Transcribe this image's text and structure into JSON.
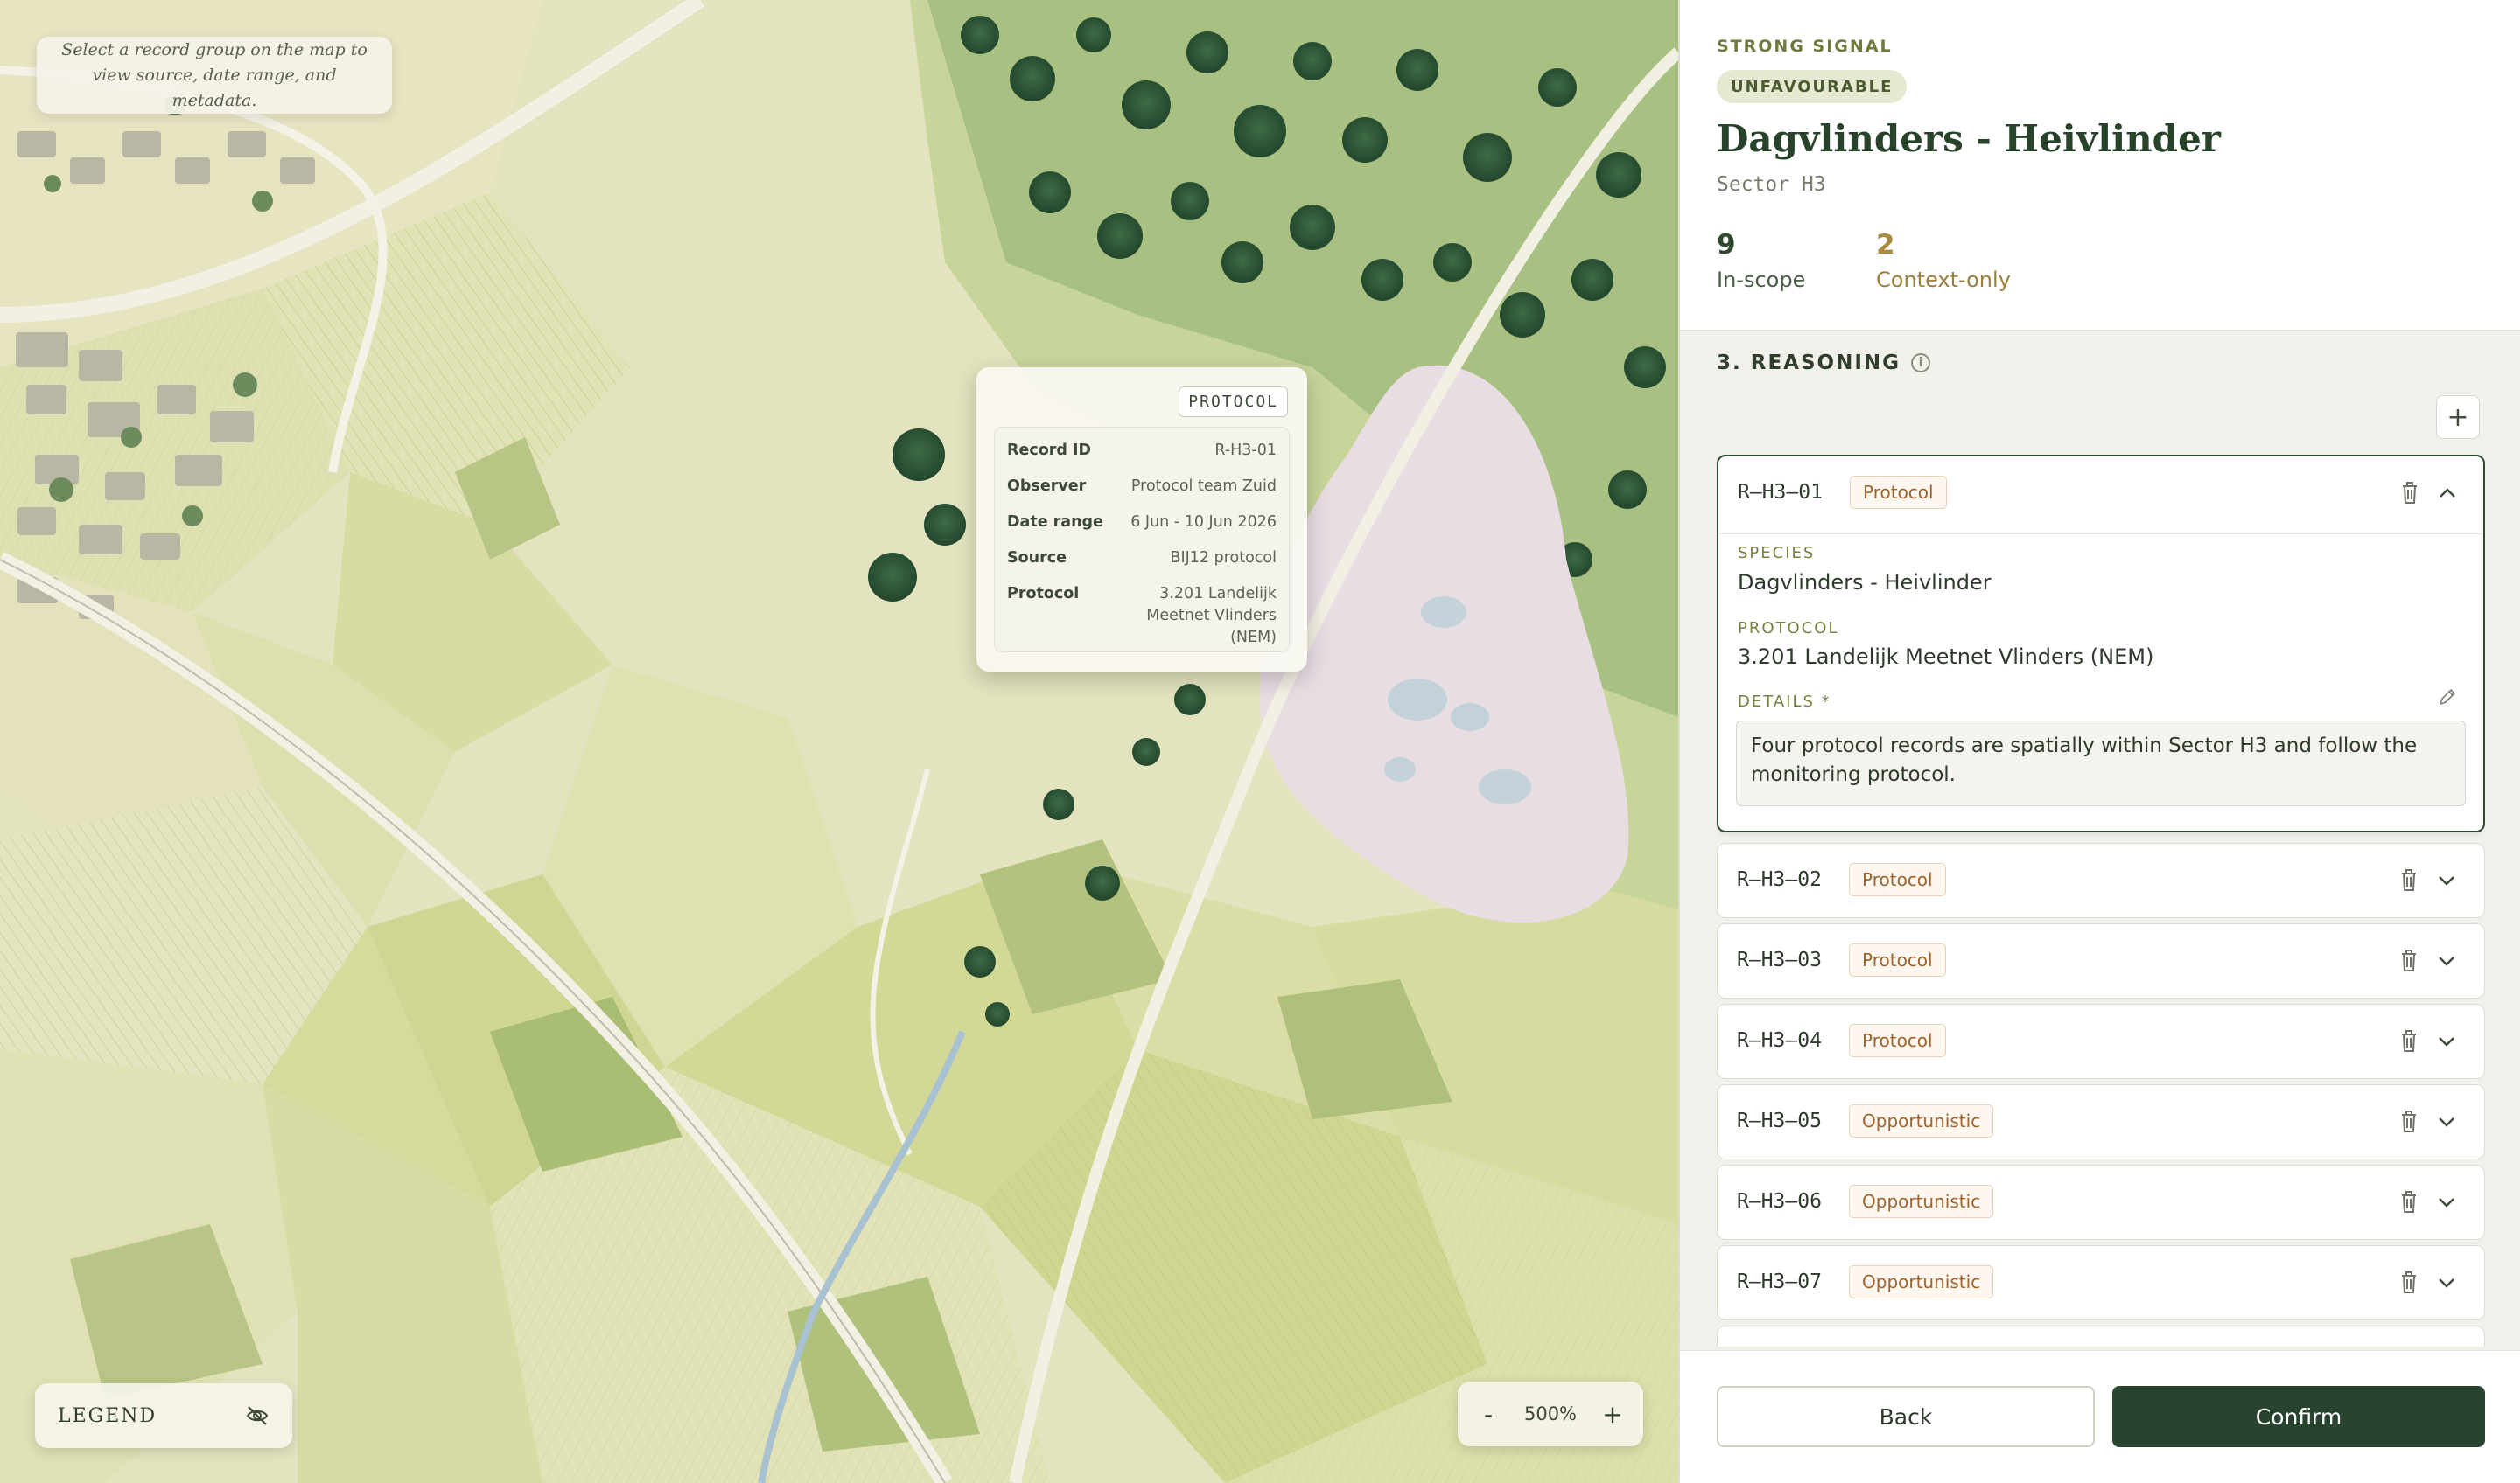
{
  "map": {
    "hint_text": "Select a record group on the map to view source, date range, and metadata.",
    "popup": {
      "tag": "PROTOCOL",
      "rows": [
        {
          "key": "Record ID",
          "value": "R-H3-01"
        },
        {
          "key": "Observer",
          "value": "Protocol team Zuid"
        },
        {
          "key": "Date range",
          "value": "6 Jun - 10 Jun 2026"
        },
        {
          "key": "Source",
          "value": "BIJ12 protocol"
        },
        {
          "key": "Protocol",
          "value": "3.201 Landelijk Meetnet Vlinders (NEM)"
        }
      ]
    },
    "legend_label": "LEGEND",
    "legend_icon": "eye-off-icon",
    "zoom": {
      "minus": "-",
      "value": "500%",
      "plus": "+"
    }
  },
  "panel": {
    "eyebrow": "STRONG SIGNAL",
    "status_pill": "UNFAVOURABLE",
    "title": "Dagvlinders - Heivlinder",
    "subtitle": "Sector H3",
    "stats": [
      {
        "value": "9",
        "label": "In-scope"
      },
      {
        "value": "2",
        "label": "Context-only"
      }
    ],
    "section_title": "3. REASONING",
    "add_label": "+",
    "records": [
      {
        "id": "R–H3–01",
        "badge": "Protocol",
        "expanded": true,
        "species_label": "SPECIES",
        "species": "Dagvlinders - Heivlinder",
        "protocol_label": "PROTOCOL",
        "protocol": "3.201 Landelijk Meetnet Vlinders (NEM)",
        "details_label": "DETAILS *",
        "details": "Four protocol records are spatially within Sector H3 and follow the monitoring protocol."
      },
      {
        "id": "R–H3–02",
        "badge": "Protocol"
      },
      {
        "id": "R–H3–03",
        "badge": "Protocol"
      },
      {
        "id": "R–H3–04",
        "badge": "Protocol"
      },
      {
        "id": "R–H3–05",
        "badge": "Opportunistic"
      },
      {
        "id": "R–H3–06",
        "badge": "Opportunistic"
      },
      {
        "id": "R–H3–07",
        "badge": "Opportunistic"
      },
      {
        "id": "",
        "badge": ""
      }
    ],
    "footer": {
      "back": "Back",
      "confirm": "Confirm"
    }
  },
  "colors": {
    "accent_dark_green": "#28432f",
    "signal_olive": "#6f7a3e",
    "context_gold": "#a88a41",
    "badge_orange": "#a0632b"
  }
}
